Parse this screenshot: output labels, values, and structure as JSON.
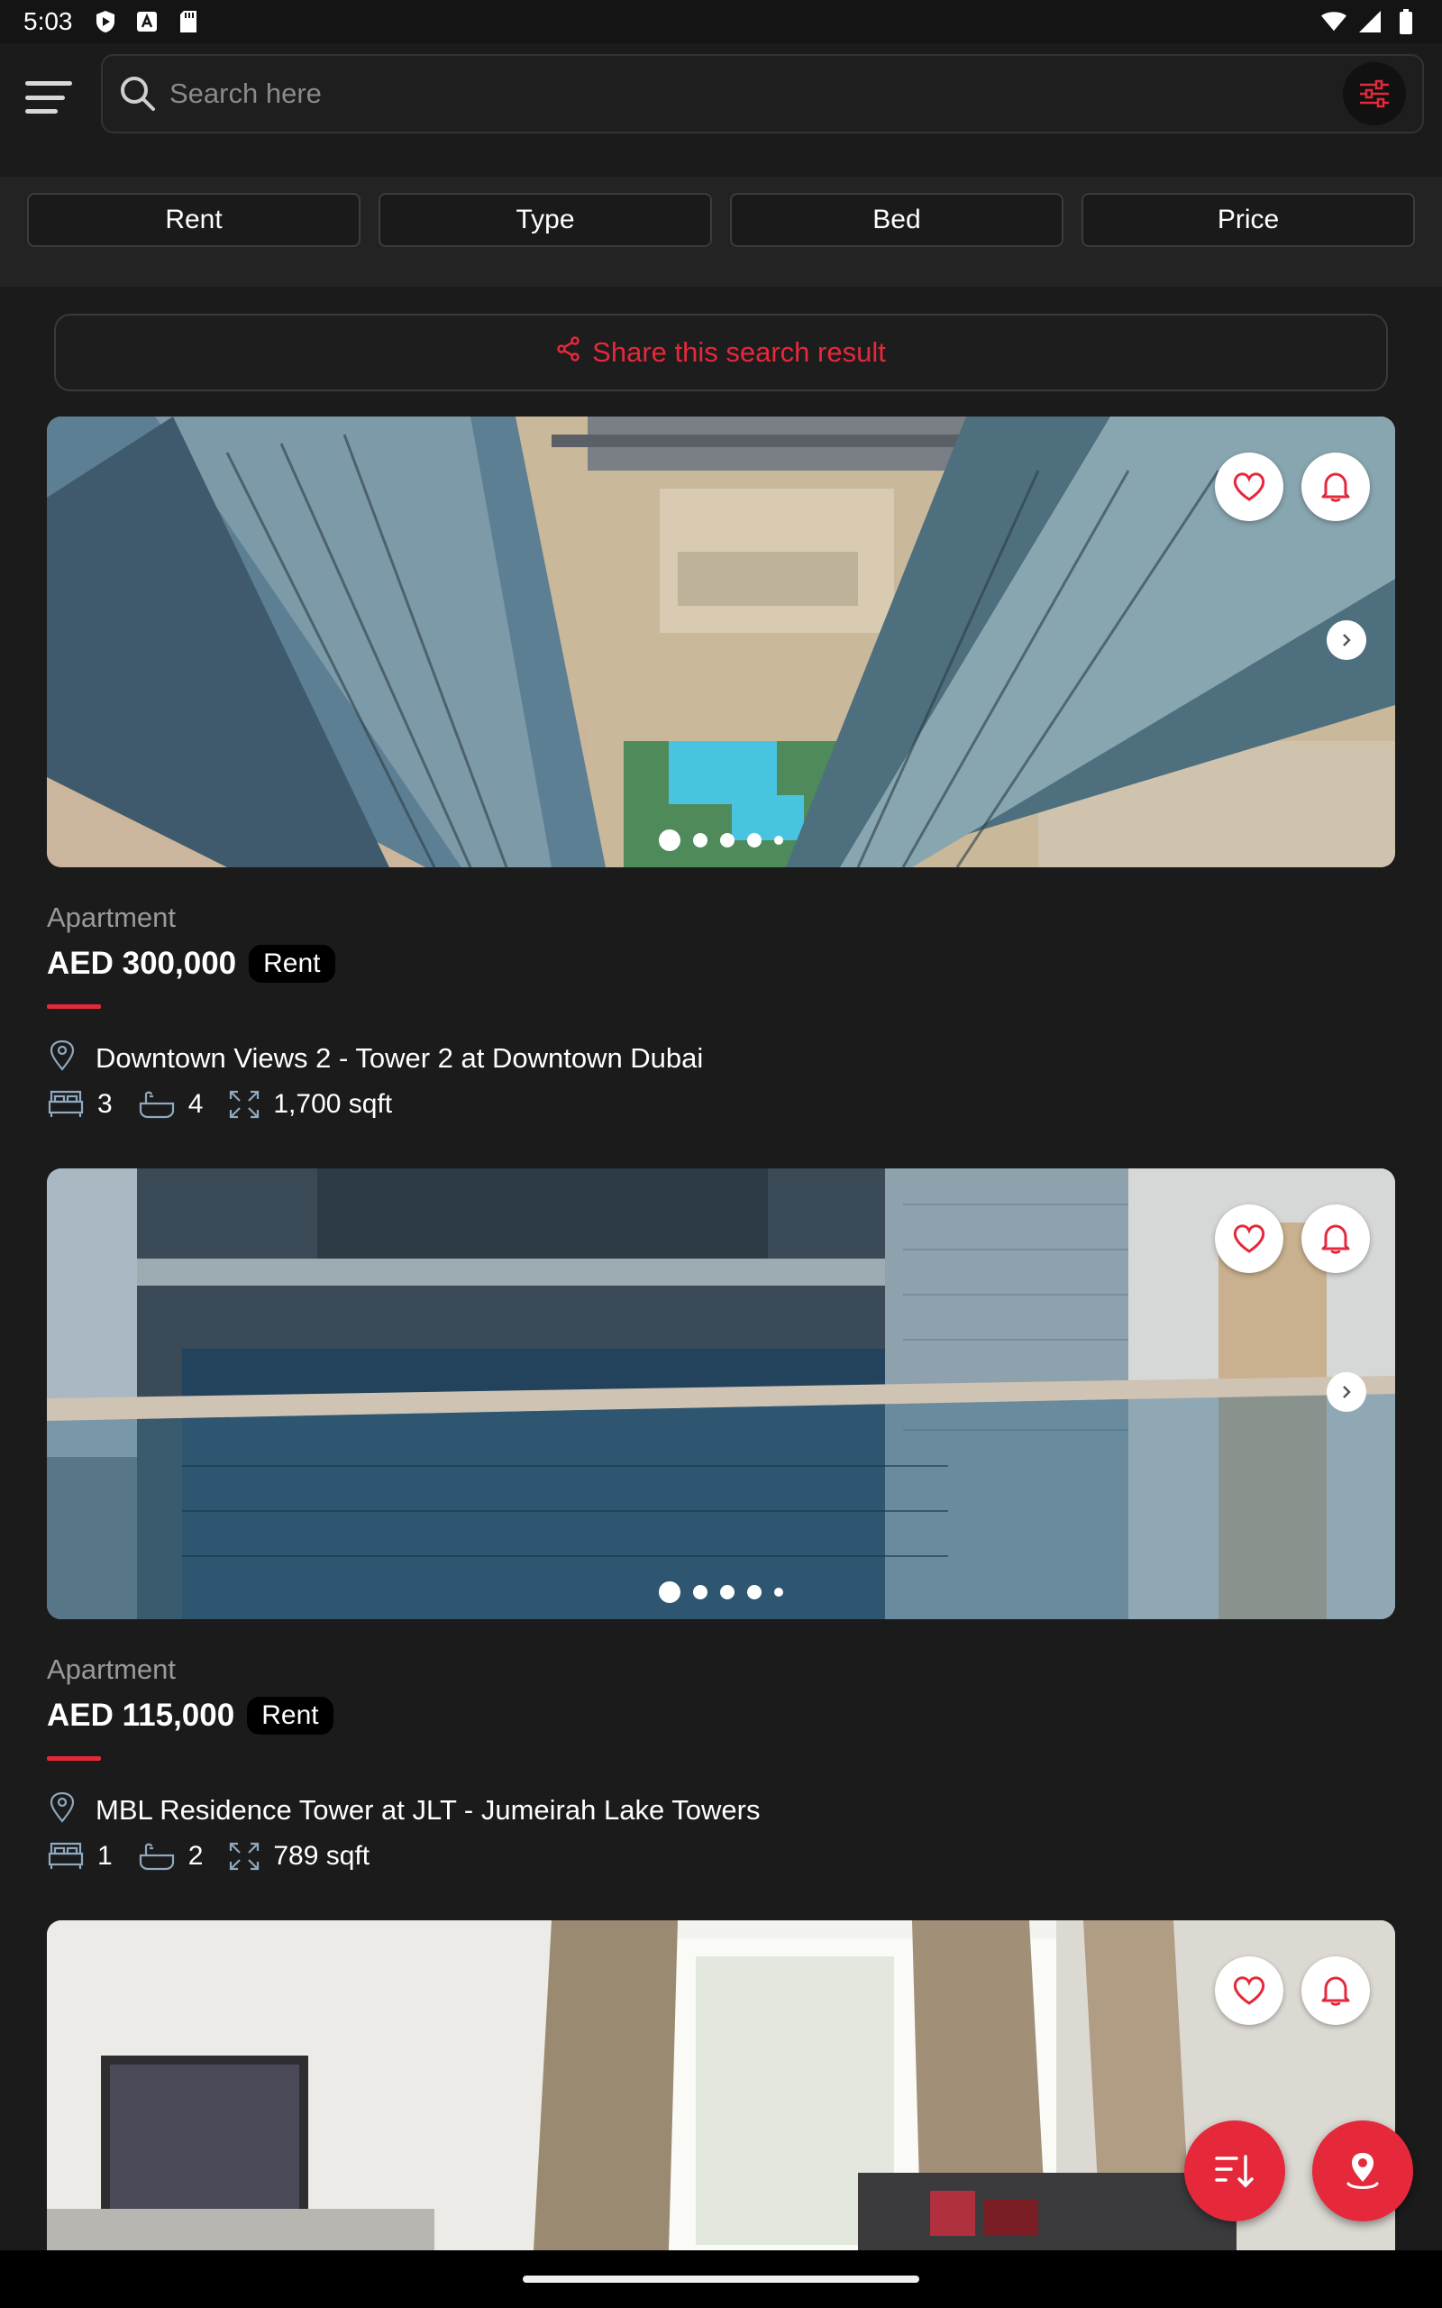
{
  "status_bar": {
    "time": "5:03"
  },
  "header": {
    "search_placeholder": "Search here"
  },
  "filters": [
    {
      "label": "Rent"
    },
    {
      "label": "Type"
    },
    {
      "label": "Bed"
    },
    {
      "label": "Price"
    }
  ],
  "share": {
    "label": "Share this search result"
  },
  "listings": [
    {
      "type": "Apartment",
      "price": "AED 300,000",
      "badge": "Rent",
      "address": "Downtown Views 2 - Tower 2 at Downtown Dubai",
      "beds": "3",
      "baths": "4",
      "area": "1,700 sqft",
      "photo_count": 5,
      "active_photo": 1
    },
    {
      "type": "Apartment",
      "price": "AED 115,000",
      "badge": "Rent",
      "address": "MBL Residence Tower at JLT - Jumeirah Lake Towers",
      "beds": "1",
      "baths": "2",
      "area": "789 sqft",
      "photo_count": 5,
      "active_photo": 1
    }
  ],
  "colors": {
    "accent": "#e5293b",
    "background": "#1b1b1b"
  },
  "icons": [
    "menu-icon",
    "search-icon",
    "filter-sliders-icon",
    "share-icon",
    "heart-icon",
    "bell-icon",
    "chevron-right-icon",
    "location-pin-icon",
    "bed-icon",
    "bath-icon",
    "area-icon",
    "sort-icon",
    "map-pin-icon"
  ]
}
